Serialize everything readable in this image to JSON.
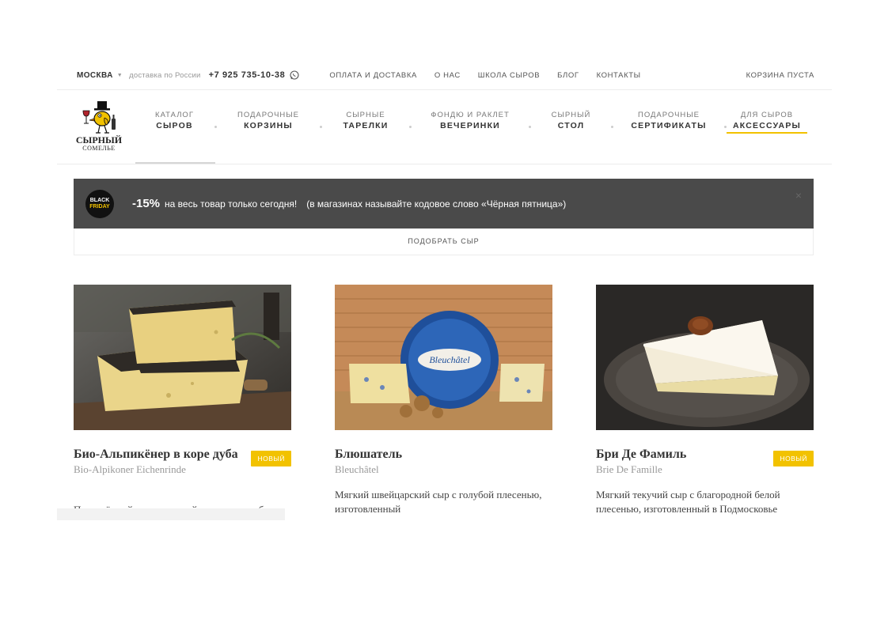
{
  "topbar": {
    "city": "МОСКВА",
    "delivery": "доставка по России",
    "phone": "+7 925 735-10-38",
    "links": [
      "ОПЛАТА И ДОСТАВКА",
      "О НАС",
      "ШКОЛА СЫРОВ",
      "БЛОГ",
      "КОНТАКТЫ"
    ],
    "cart": "КОРЗИНА ПУСТА"
  },
  "logo": {
    "line1": "СЫРНЫЙ",
    "line2": "СОМЕЛЬЕ"
  },
  "nav": [
    {
      "small": "КАТАЛОГ",
      "big": "СЫРОВ"
    },
    {
      "small": "ПОДАРОЧНЫЕ",
      "big": "КОРЗИНЫ"
    },
    {
      "small": "СЫРНЫЕ",
      "big": "ТАРЕЛКИ"
    },
    {
      "small": "ФОНДЮ И РАКЛЕТ",
      "big": "ВЕЧЕРИНКИ"
    },
    {
      "small": "СЫРНЫЙ",
      "big": "СТОЛ"
    },
    {
      "small": "ПОДАРОЧНЫЕ",
      "big": "СЕРТИФИКАТЫ"
    },
    {
      "small": "ДЛЯ СЫРОВ",
      "big": "АКСЕССУАРЫ"
    }
  ],
  "promo": {
    "badge_line1": "BLACK",
    "badge_line2": "FRIDAY",
    "percent": "-15%",
    "text": "на весь товар только сегодня!",
    "extra": "(в магазинах называйте кодовое слово «Чёрная пятница»)",
    "close": "×"
  },
  "picker": "ПОДОБРАТЬ СЫР",
  "products": [
    {
      "name": "Био-Альпикёнер в коре дуба",
      "latin": "Bio-Alpikoner Eichenrinde",
      "badge": "НОВЫЙ",
      "desc": "Полутвёрдый выдержанный сыр в коре дуба"
    },
    {
      "name": "Блюшатель",
      "latin": "Bleuchâtel",
      "badge": "",
      "desc": "Мягкий швейцарский сыр с голубой плесенью, изготовленный"
    },
    {
      "name": "Бри Де Фамиль",
      "latin": "Brie De Famille",
      "badge": "НОВЫЙ",
      "desc": "Мягкий текучий сыр с благородной белой плесенью, изготовленный в Подмосковье"
    }
  ],
  "colors": {
    "accent": "#f2c200",
    "banner": "#4a4a4a"
  }
}
